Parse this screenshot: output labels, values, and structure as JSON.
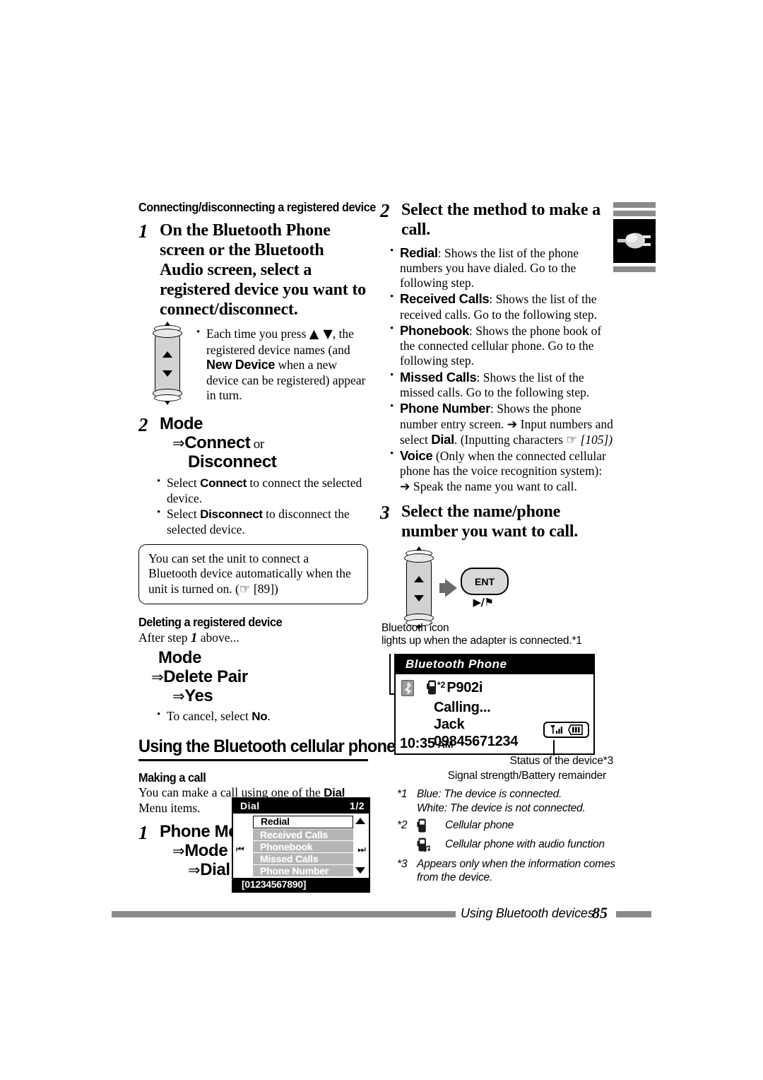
{
  "page": {
    "number": "85",
    "footer_text": "Using Bluetooth devices"
  },
  "left_column": {
    "subhead_connect": "Connecting/disconnecting a registered device",
    "step1": {
      "num": "1",
      "title": "On the Bluetooth Phone screen or the Bluetooth Audio screen, select a registered device you want to connect/disconnect.",
      "bullet_pre": "Each time you press ",
      "bullet_arrows": "▲ ▼",
      "bullet_mid": ", the registered device names (and ",
      "bullet_kw1": "New Device",
      "bullet_post": " when a new device can be registered) appear in turn."
    },
    "step2": {
      "num": "2",
      "path_l1": "Mode",
      "path_l2": "Connect",
      "path_or": " or",
      "path_l3": "Disconnect",
      "bullets": [
        {
          "pre": "Select ",
          "kw": "Connect",
          "post": " to connect the selected device."
        },
        {
          "pre": "Select ",
          "kw": "Disconnect",
          "post": " to disconnect the selected device."
        }
      ]
    },
    "notebox": "You can set the unit to connect a Bluetooth device automatically when the unit is turned on. (☞ [89])",
    "subhead_delete": "Deleting a registered device",
    "after_step_pre": "After step ",
    "after_step_num": "1",
    "after_step_post": " above...",
    "delete_path": {
      "l1": "Mode",
      "l2": "Delete Pair",
      "l3": "Yes"
    },
    "delete_bullet_pre": "To cancel, select ",
    "delete_bullet_kw": "No",
    "delete_bullet_post": ".",
    "section_title": "Using the Bluetooth cellular phone",
    "subhead_making": "Making a call",
    "making_pre": "You can make a call using one of the ",
    "making_kw": "Dial",
    "making_post": " Menu items.",
    "step1b": {
      "num": "1",
      "l1": "Phone Menu",
      "l2": "Mode",
      "l3": "Dial"
    }
  },
  "dial_screen": {
    "title": "Dial",
    "page_indicator": "1/2",
    "items": [
      {
        "label": "Redial",
        "selected": true
      },
      {
        "label": "Received Calls",
        "selected": false
      },
      {
        "label": "Phonebook",
        "selected": false
      },
      {
        "label": "Missed Calls",
        "selected": false
      },
      {
        "label": "Phone Number",
        "selected": false
      }
    ],
    "footer": "[01234567890]",
    "left_icon": "skip-back-icon",
    "right_icon": "skip-forward-icon"
  },
  "right_column": {
    "step2": {
      "num": "2",
      "title": "Select the method to make a call.",
      "bullets": [
        {
          "kw": "Redial",
          "text": ": Shows the list of the phone numbers you have dialed. Go to the following step."
        },
        {
          "kw": "Received Calls",
          "text": ": Shows the list of the received calls. Go to the following step."
        },
        {
          "kw": "Phonebook",
          "text": ": Shows the phone book of the connected cellular phone. Go to the following step."
        },
        {
          "kw": "Missed Calls",
          "text": ": Shows the list of the missed calls. Go to the following step."
        },
        {
          "kw": "Phone Number",
          "text": ": Shows the phone number entry screen. ➔ Input numbers and select ",
          "kw2": "Dial",
          "text2": ". (Inputting characters ☞ ",
          "italic_ref": "[105])"
        },
        {
          "kw": "Voice",
          "text": " (Only when the connected cellular phone has the voice recognition system): ➔ Speak the name you want to call."
        }
      ]
    },
    "step3": {
      "num": "3",
      "title": "Select the name/phone number you want to call.",
      "ent_label": "ENT",
      "ent_sub": "▶/⚑"
    }
  },
  "bt_screen": {
    "callout_line1": "Bluetooth icon",
    "callout_line2": "lights up when the adapter is connected.*1",
    "title": "Bluetooth Phone",
    "device_marker": "*2",
    "device_name": "P902i",
    "status_line": "Calling...",
    "caller_name": "Jack",
    "phone_number": "09845671234",
    "time": "10:35",
    "time_suffix": "AM",
    "caption_status": "Status of the device*3",
    "caption_signal": "Signal strength/Battery remainder"
  },
  "footnotes": {
    "n1_label": "*1",
    "n1_line1": "Blue: The device is connected.",
    "n1_line2": "White: The device is not connected.",
    "n2_label": "*2",
    "n2_text1": "Cellular phone",
    "n2_text2": "Cellular phone with audio function",
    "n3_label": "*3",
    "n3_text": "Appears only when the information comes from the device."
  },
  "colors": {
    "rule": "#000000",
    "bar_gray": "#8a8a8a",
    "lcd_row_gray": "#b5b5b5",
    "rocker_gray": "#d2d2d2"
  }
}
